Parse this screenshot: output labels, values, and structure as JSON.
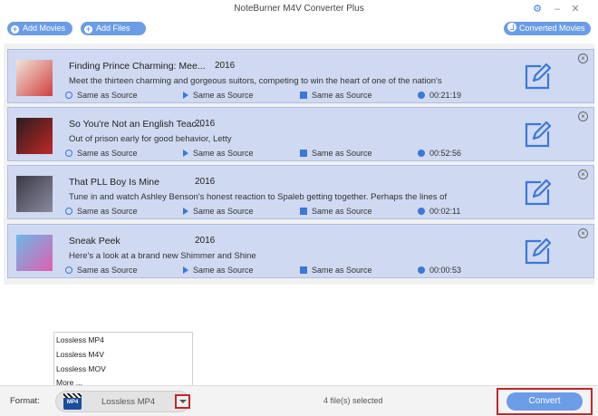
{
  "window": {
    "title": "NoteBurner M4V Converter Plus",
    "controls": {
      "settings": "⚙",
      "minimize": "–",
      "close": "✕"
    }
  },
  "toolbar": {
    "add_movies": "Add Movies",
    "add_files": "Add Files",
    "converted_movies": "Converted Movies"
  },
  "items": [
    {
      "title": "Finding Prince Charming: Mee...",
      "year": "2016",
      "description": "Meet the thirteen charming and gorgeous suitors, competing to win the heart of one of the nation's",
      "video": "Same as Source",
      "audio": "Same as Source",
      "subtitle": "Same as Source",
      "duration": "00:21:19",
      "thumb_colors": [
        "#f0e4d8",
        "#d04040"
      ]
    },
    {
      "title": "So You're Not an English Teac...",
      "year": "2016",
      "description": "Out of prison early for good behavior, Letty",
      "video": "Same as Source",
      "audio": "Same as Source",
      "subtitle": "Same as Source",
      "duration": "00:52:56",
      "thumb_colors": [
        "#2a1c1c",
        "#c02828"
      ]
    },
    {
      "title": "That PLL Boy Is Mine",
      "year": "2016",
      "description": "Tune in and watch Ashley Benson's honest reaction to Spaleb getting together. Perhaps the lines of",
      "video": "Same as Source",
      "audio": "Same as Source",
      "subtitle": "Same as Source",
      "duration": "00:02:11",
      "thumb_colors": [
        "#3a3a44",
        "#8a8aa0"
      ]
    },
    {
      "title": "Sneak Peek",
      "year": "2016",
      "description": "Here's a look at a brand new Shimmer and Shine",
      "video": "Same as Source",
      "audio": "Same as Source",
      "subtitle": "Same as Source",
      "duration": "00:00:53",
      "thumb_colors": [
        "#6ab8e8",
        "#e060b0"
      ]
    }
  ],
  "format_dropdown": {
    "options": [
      "Lossless MP4",
      "Lossless M4V",
      "Lossless MOV",
      "More ..."
    ]
  },
  "bottom": {
    "format_label": "Format:",
    "format_value": "Lossless MP4",
    "format_icon_text": "MP4",
    "files_selected": "4 file(s) selected",
    "convert": "Convert"
  },
  "colors": {
    "accent": "#6b9de6",
    "item_bg": "#cfd9f1",
    "highlight": "#c0272d"
  }
}
